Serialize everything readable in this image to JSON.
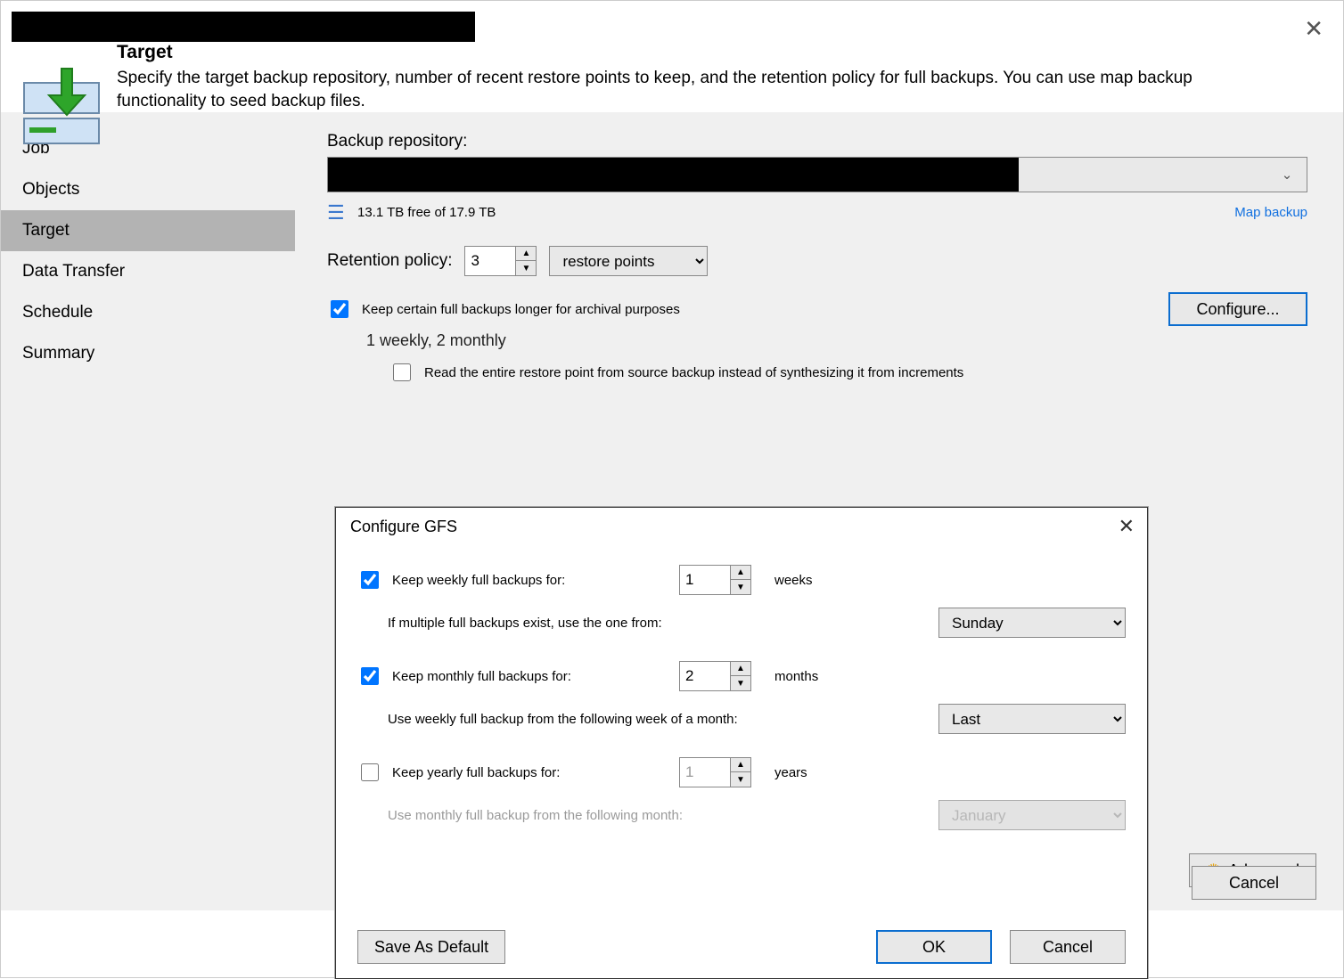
{
  "window": {
    "close_glyph": "✕"
  },
  "header": {
    "title": "Target",
    "description": "Specify the target backup repository, number of recent restore points to keep, and the retention policy for full backups. You can use map backup functionality to seed backup files."
  },
  "nav": {
    "items": [
      {
        "label": "Job"
      },
      {
        "label": "Objects"
      },
      {
        "label": "Target"
      },
      {
        "label": "Data Transfer"
      },
      {
        "label": "Schedule"
      },
      {
        "label": "Summary"
      }
    ],
    "active_index": 2
  },
  "content": {
    "repo_label": "Backup repository:",
    "storage_free": "13.1 TB free of 17.9 TB",
    "map_backup": "Map backup",
    "retention_label": "Retention policy:",
    "retention_value": "3",
    "retention_unit": "restore points",
    "archival_label": "Keep certain full backups longer for archival purposes",
    "archival_checked": true,
    "archival_summary": "1 weekly, 2 monthly",
    "read_entire_label": "Read the entire restore point from source backup instead of synthesizing it from increments",
    "read_entire_checked": false,
    "configure_btn": "Configure...",
    "advanced_btn": "Advanced"
  },
  "footer": {
    "cancel": "Cancel"
  },
  "modal": {
    "title": "Configure GFS",
    "close_glyph": "✕",
    "weekly": {
      "checked": true,
      "label": "Keep weekly full backups for:",
      "value": "1",
      "unit": "weeks",
      "desc": "If multiple full backups exist, use the one from:",
      "select": "Sunday"
    },
    "monthly": {
      "checked": true,
      "label": "Keep monthly full backups for:",
      "value": "2",
      "unit": "months",
      "desc": "Use weekly full backup from the following week of a month:",
      "select": "Last"
    },
    "yearly": {
      "checked": false,
      "label": "Keep yearly full backups for:",
      "value": "1",
      "unit": "years",
      "desc": "Use monthly full backup from the following month:",
      "select": "January"
    },
    "save_default": "Save As Default",
    "ok": "OK",
    "cancel": "Cancel"
  }
}
